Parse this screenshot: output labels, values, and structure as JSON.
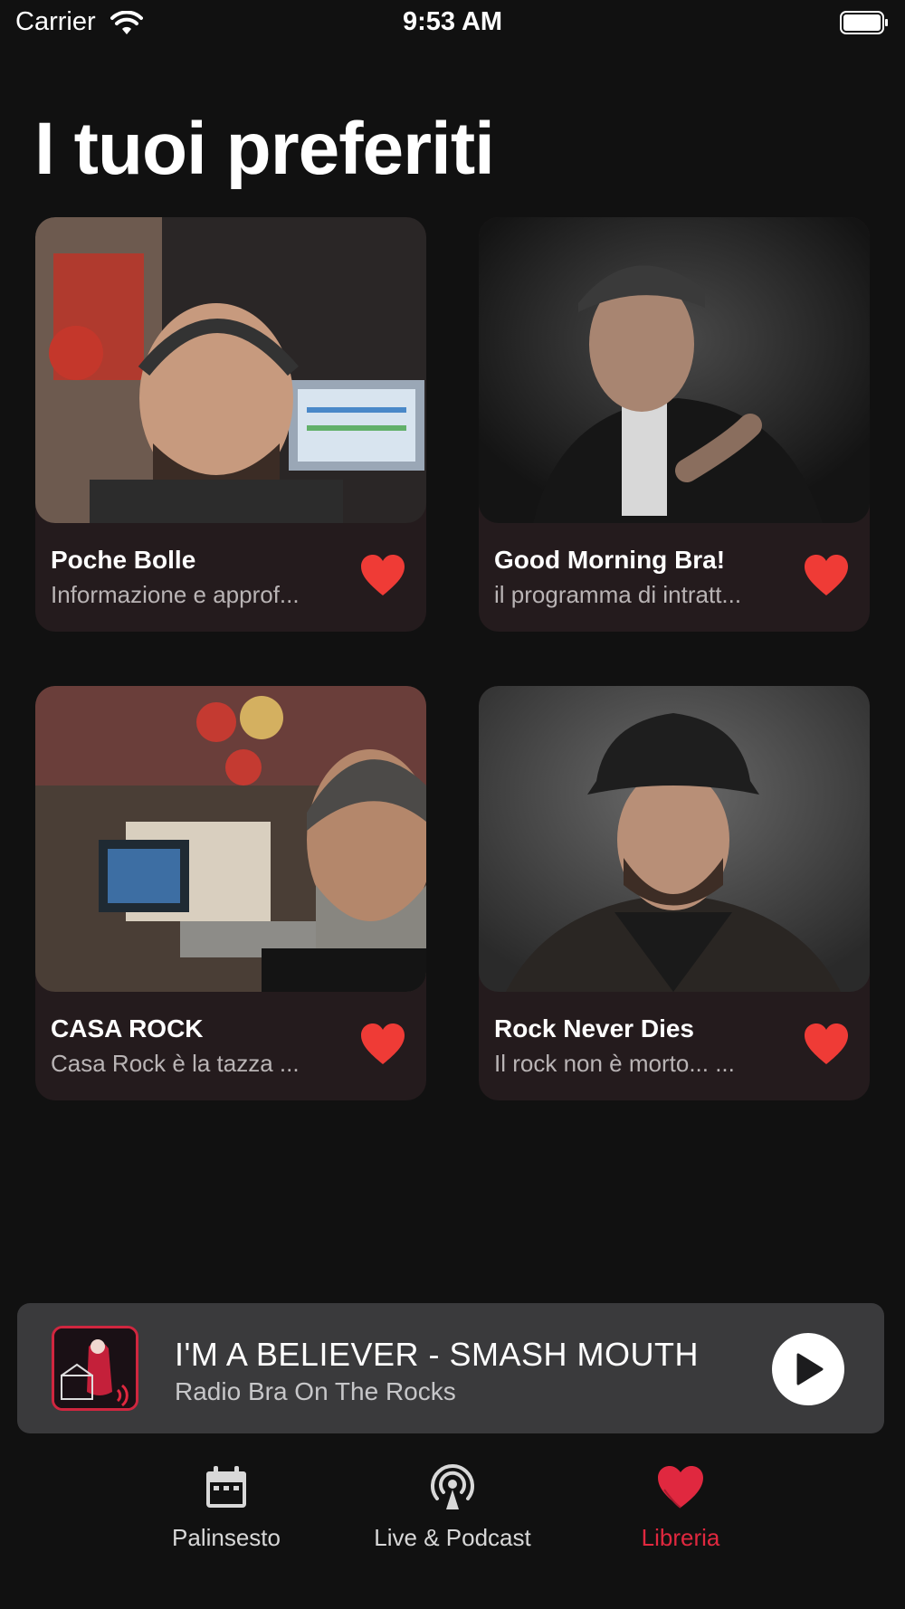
{
  "status_bar": {
    "carrier": "Carrier",
    "time": "9:53 AM"
  },
  "page": {
    "title": "I tuoi preferiti"
  },
  "favorites": [
    {
      "name": "Poche Bolle",
      "description": "Informazione e approf...",
      "favorited": true
    },
    {
      "name": "Good Morning Bra!",
      "description": "il programma di intratt...",
      "favorited": true
    },
    {
      "name": "CASA ROCK",
      "description": "Casa Rock è la tazza ...",
      "favorited": true
    },
    {
      "name": "Rock Never Dies",
      "description": "Il rock non è morto... ...",
      "favorited": true
    }
  ],
  "player": {
    "song": "I'M A BELIEVER - SMASH MOUTH",
    "station": "Radio Bra On The Rocks"
  },
  "tabs": [
    {
      "label": "Palinsesto",
      "icon": "calendar-icon",
      "active": false
    },
    {
      "label": "Live & Podcast",
      "icon": "podcast-icon",
      "active": false
    },
    {
      "label": "Libreria",
      "icon": "heart-icon",
      "active": true
    }
  ],
  "colors": {
    "accent": "#e0283f",
    "heart": "#ef3b36",
    "background": "#111111",
    "card": "#241b1d",
    "player": "#3a3a3c"
  }
}
